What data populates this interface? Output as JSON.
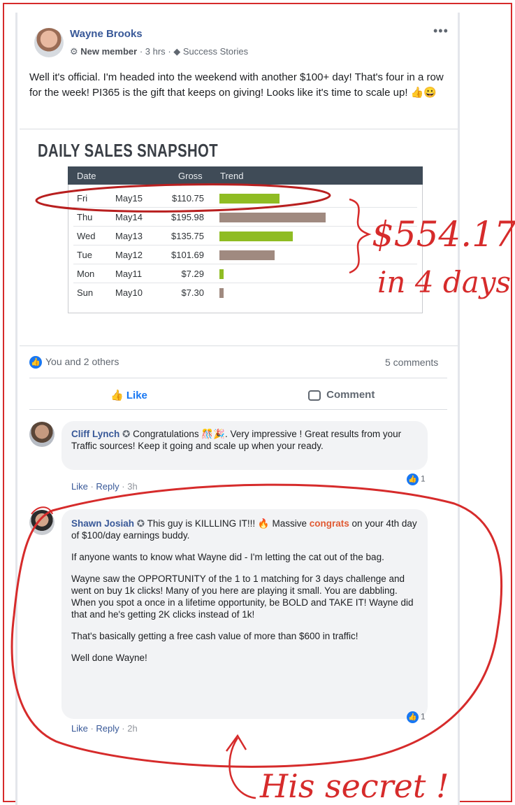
{
  "post": {
    "author": "Wayne Brooks",
    "badge": "New member",
    "time": "3 hrs",
    "group_tag": "Success Stories",
    "text": "Well it's official. I'm headed into the weekend with another $100+ day! That's four in a row for the week! PI365 is the gift that keeps on giving! Looks like it's time to scale up! 👍😀"
  },
  "snapshot": {
    "title": "DAILY SALES SNAPSHOT",
    "headers": [
      "Date",
      "Gross",
      "Trend"
    ],
    "rows": [
      {
        "day": "Fri",
        "date": "May15",
        "gross": "$110.75",
        "value": 110.75,
        "color": "#8fbc23"
      },
      {
        "day": "Thu",
        "date": "May14",
        "gross": "$195.98",
        "value": 195.98,
        "color": "#a08a80"
      },
      {
        "day": "Wed",
        "date": "May13",
        "gross": "$135.75",
        "value": 135.75,
        "color": "#8fbc23"
      },
      {
        "day": "Tue",
        "date": "May12",
        "gross": "$101.69",
        "value": 101.69,
        "color": "#a08a80"
      },
      {
        "day": "Mon",
        "date": "May11",
        "gross": "$7.29",
        "value": 7.29,
        "color": "#8fbc23"
      },
      {
        "day": "Sun",
        "date": "May10",
        "gross": "$7.30",
        "value": 7.3,
        "color": "#a08a80"
      }
    ]
  },
  "handwriting": {
    "total": "$554.17",
    "period": "in 4 days",
    "secret": "His secret !"
  },
  "reactions": {
    "summary": "You and 2 others",
    "comments": "5 comments"
  },
  "actions": {
    "like": "Like",
    "comment": "Comment"
  },
  "comments": [
    {
      "author": "Cliff Lynch",
      "text": "Congratulations 🎊🎉. Very impressive ! Great results from your Traffic sources! Keep it going and scale up when your ready.",
      "like": "Like",
      "reply": "Reply",
      "time": "3h",
      "reaction_count": "1"
    },
    {
      "author": "Shawn Josiah",
      "text_before": "This guy is KILLLING IT!!! 🔥 Massive",
      "highlight": "congrats",
      "text_after": "on your 4th day of $100/day earnings buddy.",
      "p2": "If anyone wants to know what Wayne did - I'm letting the cat out of the bag.",
      "p3": "Wayne saw the OPPORTUNITY of the 1 to 1 matching for 3 days challenge and went on buy 1k clicks! Many of you here are playing it small. You are dabbling. When you spot a once in a lifetime opportunity, be BOLD and TAKE IT! Wayne did that and he's getting 2K clicks instead of 1k!",
      "p4": "That's basically getting a free cash value of more than $600 in traffic!",
      "p5": "Well done Wayne!",
      "like": "Like",
      "reply": "Reply",
      "time": "2h",
      "reaction_count": "1"
    }
  ],
  "colors": {
    "link_blue": "#385898",
    "fb_blue": "#1877f2",
    "annotation_red": "#d62b2b"
  }
}
